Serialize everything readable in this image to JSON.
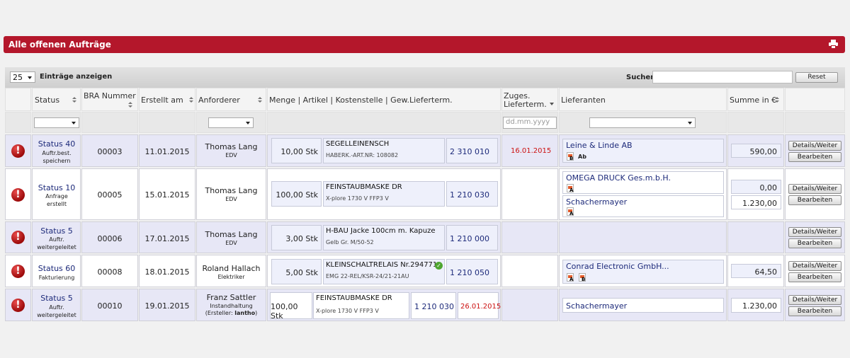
{
  "title": "Alle offenen Aufträge",
  "colors": {
    "title_bar": "#b4172b",
    "link": "#1d2a7a",
    "highlight_row": "#e7e7f6",
    "date_red": "#cc1111"
  },
  "toolbar": {
    "page_length": "25",
    "length_label": "Einträge anzeigen",
    "search_label": "Suchen",
    "search_value": "",
    "reset_label": "Reset"
  },
  "columns": {
    "status": "Status",
    "bra": "BRA Nummer",
    "created": "Erstellt am",
    "requester": "Anforderer",
    "article": "Menge | Artikel | Kostenstelle | Gew.Lieferterm.",
    "confirmed1": "Zuges.",
    "confirmed2": "Lieferterm.",
    "suppliers": "Lieferanten",
    "sum": "Summe in €"
  },
  "filters": {
    "date_placeholder": "dd.mm.yyyy"
  },
  "buttons": {
    "details": "Details/Weiter",
    "edit": "Bearbeiten"
  },
  "rows": [
    {
      "status": "Status 40",
      "status_sub1": "Auftr.best.",
      "status_sub2": "speichern",
      "bra": "00003",
      "created": "11.01.2015",
      "requester": "Thomas Lang",
      "dept": "EDV",
      "qty": "10,00 Stk",
      "article": "SEGELLEINENSCH",
      "article_sub": "HABERK.-ART.NR: 108082",
      "cost": "2 310 010",
      "confirmed": "16.01.2015",
      "supplier": "Leine & Linde AB",
      "doc1": "B",
      "doc2": "Ab",
      "sum": "590,00"
    },
    {
      "status": "Status 10",
      "status_sub1": "Anfrage",
      "status_sub2": "erstellt",
      "bra": "00005",
      "created": "15.01.2015",
      "requester": "Thomas Lang",
      "dept": "EDV",
      "qty": "100,00 Stk",
      "article": "FEINSTAUBMASKE DR",
      "article_sub": "X-plore 1730 V FFP3 V",
      "cost": "1 210 030",
      "supplier": "OMEGA DRUCK Ges.m.b.H.",
      "doc1": "A",
      "sum": "0,00",
      "supplier2": "Schachermayer",
      "doc2": "A",
      "sum2": "1.230,00"
    },
    {
      "status": "Status 5",
      "status_sub1": "Auftr.",
      "status_sub2": "weitergeleitet",
      "bra": "00006",
      "created": "17.01.2015",
      "requester": "Thomas Lang",
      "dept": "EDV",
      "qty": "3,00 Stk",
      "article": "H-BAU Jacke 100cm m. Kapuze",
      "article_sub": "Gelb Gr. M/50-52",
      "cost": "1 210 000"
    },
    {
      "status": "Status 60",
      "status_sub1": "Fakturierung",
      "bra": "00008",
      "created": "18.01.2015",
      "requester": "Roland Hallach",
      "dept": "Elektriker",
      "qty": "5,00 Stk",
      "article": "KLEINSCHALTRELAIS Nr.294771",
      "article_sub": "EMG 22-REL/KSR-24/21-21AU",
      "cost": "1 210 050",
      "supplier": "Conrad Electronic GmbH...",
      "doc1": "A",
      "doc2": "B",
      "sum": "64,50"
    },
    {
      "status": "Status 5",
      "status_sub1": "Auftr.",
      "status_sub2": "weitergeleitet",
      "bra": "00010",
      "created": "19.01.2015",
      "requester": "Franz Sattler",
      "dept": "Instandhaltung",
      "creator_prefix": "(Ersteller:",
      "creator": "lantho",
      "creator_suffix": ")",
      "qty": "100,00 Stk",
      "article": "FEINSTAUBMASKE DR",
      "article_sub": "X-plore 1730 V FFP3 V",
      "cost": "1 210 030",
      "wish_date": "26.01.2015",
      "supplier": "Schachermayer",
      "sum": "1.230,00"
    }
  ]
}
